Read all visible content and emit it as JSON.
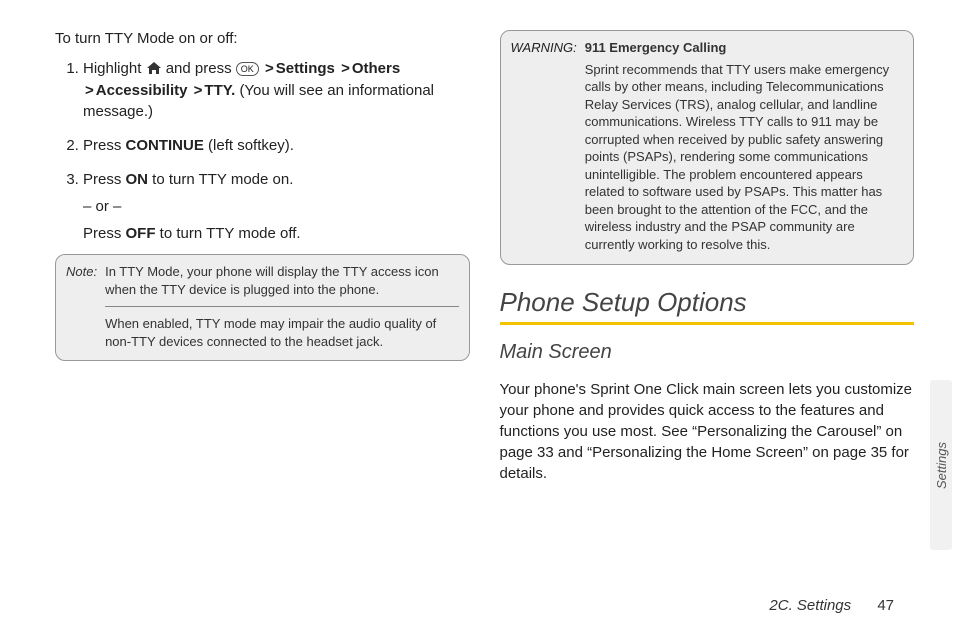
{
  "left": {
    "intro": "To turn TTY Mode on or off:",
    "step1_a": "Highlight ",
    "step1_b": " and press ",
    "ok_text": "MENU OK",
    "nav1": "Settings",
    "nav2": "Others",
    "nav3": "Accessibility",
    "nav4": "TTY.",
    "step1_c": " (You will see an informational message.)",
    "step2_a": "Press ",
    "step2_key": "CONTINUE",
    "step2_b": " (left softkey).",
    "step3_a": "Press ",
    "step3_key": "ON",
    "step3_b": " to turn TTY mode on.",
    "or": "– or –",
    "step3c_a": "Press ",
    "step3c_key": "OFF",
    "step3c_b": " to turn TTY mode off.",
    "note_label": "Note:",
    "note_p1": "In TTY Mode, your phone will display the TTY access icon when the TTY device is plugged into the phone.",
    "note_p2": "When enabled, TTY mode may impair the audio quality of non-TTY devices connected to the headset jack."
  },
  "right": {
    "warn_label": "WARNING:",
    "warn_title": "911 Emergency Calling",
    "warn_body": "Sprint recommends that TTY users make emergency calls by other means, including Telecommunications Relay Services (TRS), analog cellular, and landline communications. Wireless TTY calls to 911 may be corrupted when received by public safety answering points (PSAPs), rendering some communications unintelligible. The problem encountered appears related to software used by PSAPs. This matter has been brought to the attention of the FCC, and the wireless industry and the PSAP community are currently working to resolve this.",
    "section_title": "Phone Setup Options",
    "subsection_title": "Main Screen",
    "body": "Your phone's Sprint One Click main screen lets you customize your phone and provides quick access to the features and functions you use most. See “Personalizing the Carousel” on page 33 and “Personalizing the Home Screen” on page 35 for details."
  },
  "side_tab": "Settings",
  "footer_section": "2C. Settings",
  "footer_page": "47"
}
